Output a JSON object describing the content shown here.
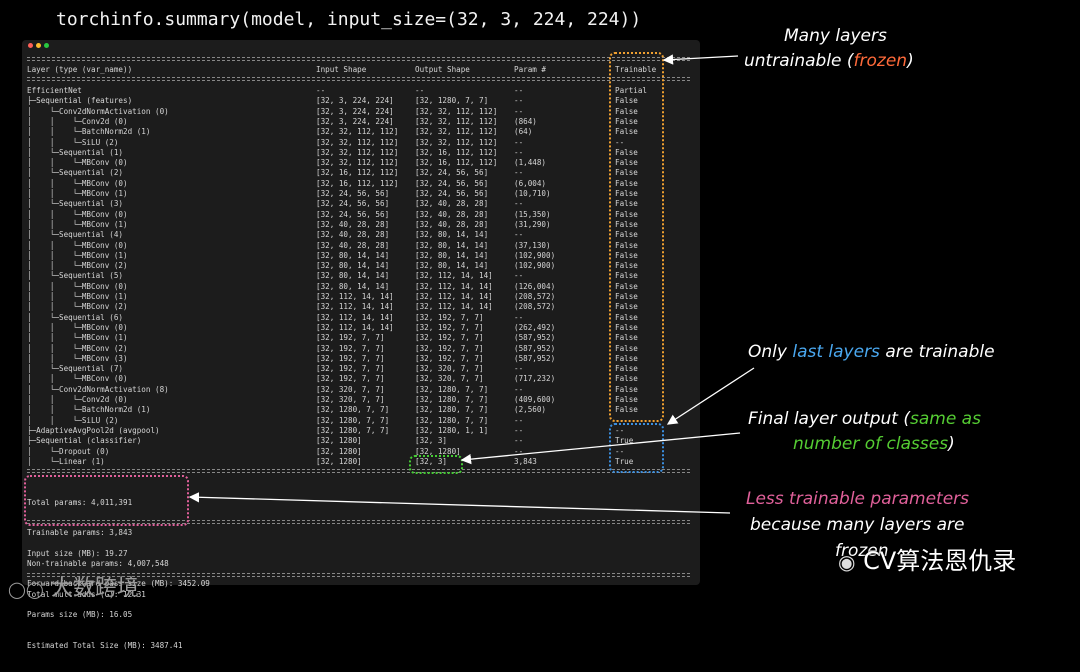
{
  "code_line": "torchinfo.summary(model, input_size=(32, 3, 224, 224))",
  "window_dots": [
    "#ff5f57",
    "#febc2e",
    "#28c840"
  ],
  "header": {
    "layer": "Layer (type (var_name))",
    "input": "Input Shape",
    "output": "Output Shape",
    "param": "Param #",
    "trainable": "Trainable"
  },
  "rows": [
    [
      "EfficientNet",
      "--",
      "--",
      "--",
      "Partial"
    ],
    [
      "├─Sequential (features)",
      "[32, 3, 224, 224]",
      "[32, 1280, 7, 7]",
      "--",
      "False"
    ],
    [
      "│    └─Conv2dNormActivation (0)",
      "[32, 3, 224, 224]",
      "[32, 32, 112, 112]",
      "--",
      "False"
    ],
    [
      "│    │    └─Conv2d (0)",
      "[32, 3, 224, 224]",
      "[32, 32, 112, 112]",
      "(864)",
      "False"
    ],
    [
      "│    │    └─BatchNorm2d (1)",
      "[32, 32, 112, 112]",
      "[32, 32, 112, 112]",
      "(64)",
      "False"
    ],
    [
      "│    │    └─SiLU (2)",
      "[32, 32, 112, 112]",
      "[32, 32, 112, 112]",
      "--",
      "--"
    ],
    [
      "│    └─Sequential (1)",
      "[32, 32, 112, 112]",
      "[32, 16, 112, 112]",
      "--",
      "False"
    ],
    [
      "│    │    └─MBConv (0)",
      "[32, 32, 112, 112]",
      "[32, 16, 112, 112]",
      "(1,448)",
      "False"
    ],
    [
      "│    └─Sequential (2)",
      "[32, 16, 112, 112]",
      "[32, 24, 56, 56]",
      "--",
      "False"
    ],
    [
      "│    │    └─MBConv (0)",
      "[32, 16, 112, 112]",
      "[32, 24, 56, 56]",
      "(6,004)",
      "False"
    ],
    [
      "│    │    └─MBConv (1)",
      "[32, 24, 56, 56]",
      "[32, 24, 56, 56]",
      "(10,710)",
      "False"
    ],
    [
      "│    └─Sequential (3)",
      "[32, 24, 56, 56]",
      "[32, 40, 28, 28]",
      "--",
      "False"
    ],
    [
      "│    │    └─MBConv (0)",
      "[32, 24, 56, 56]",
      "[32, 40, 28, 28]",
      "(15,350)",
      "False"
    ],
    [
      "│    │    └─MBConv (1)",
      "[32, 40, 28, 28]",
      "[32, 40, 28, 28]",
      "(31,290)",
      "False"
    ],
    [
      "│    └─Sequential (4)",
      "[32, 40, 28, 28]",
      "[32, 80, 14, 14]",
      "--",
      "False"
    ],
    [
      "│    │    └─MBConv (0)",
      "[32, 40, 28, 28]",
      "[32, 80, 14, 14]",
      "(37,130)",
      "False"
    ],
    [
      "│    │    └─MBConv (1)",
      "[32, 80, 14, 14]",
      "[32, 80, 14, 14]",
      "(102,900)",
      "False"
    ],
    [
      "│    │    └─MBConv (2)",
      "[32, 80, 14, 14]",
      "[32, 80, 14, 14]",
      "(102,900)",
      "False"
    ],
    [
      "│    └─Sequential (5)",
      "[32, 80, 14, 14]",
      "[32, 112, 14, 14]",
      "--",
      "False"
    ],
    [
      "│    │    └─MBConv (0)",
      "[32, 80, 14, 14]",
      "[32, 112, 14, 14]",
      "(126,004)",
      "False"
    ],
    [
      "│    │    └─MBConv (1)",
      "[32, 112, 14, 14]",
      "[32, 112, 14, 14]",
      "(208,572)",
      "False"
    ],
    [
      "│    │    └─MBConv (2)",
      "[32, 112, 14, 14]",
      "[32, 112, 14, 14]",
      "(208,572)",
      "False"
    ],
    [
      "│    └─Sequential (6)",
      "[32, 112, 14, 14]",
      "[32, 192, 7, 7]",
      "--",
      "False"
    ],
    [
      "│    │    └─MBConv (0)",
      "[32, 112, 14, 14]",
      "[32, 192, 7, 7]",
      "(262,492)",
      "False"
    ],
    [
      "│    │    └─MBConv (1)",
      "[32, 192, 7, 7]",
      "[32, 192, 7, 7]",
      "(587,952)",
      "False"
    ],
    [
      "│    │    └─MBConv (2)",
      "[32, 192, 7, 7]",
      "[32, 192, 7, 7]",
      "(587,952)",
      "False"
    ],
    [
      "│    │    └─MBConv (3)",
      "[32, 192, 7, 7]",
      "[32, 192, 7, 7]",
      "(587,952)",
      "False"
    ],
    [
      "│    └─Sequential (7)",
      "[32, 192, 7, 7]",
      "[32, 320, 7, 7]",
      "--",
      "False"
    ],
    [
      "│    │    └─MBConv (0)",
      "[32, 192, 7, 7]",
      "[32, 320, 7, 7]",
      "(717,232)",
      "False"
    ],
    [
      "│    └─Conv2dNormActivation (8)",
      "[32, 320, 7, 7]",
      "[32, 1280, 7, 7]",
      "--",
      "False"
    ],
    [
      "│    │    └─Conv2d (0)",
      "[32, 320, 7, 7]",
      "[32, 1280, 7, 7]",
      "(409,600)",
      "False"
    ],
    [
      "│    │    └─BatchNorm2d (1)",
      "[32, 1280, 7, 7]",
      "[32, 1280, 7, 7]",
      "(2,560)",
      "False"
    ],
    [
      "│    │    └─SiLU (2)",
      "[32, 1280, 7, 7]",
      "[32, 1280, 7, 7]",
      "--",
      "--"
    ],
    [
      "├─AdaptiveAvgPool2d (avgpool)",
      "[32, 1280, 7, 7]",
      "[32, 1280, 1, 1]",
      "--",
      "--"
    ],
    [
      "├─Sequential (classifier)",
      "[32, 1280]",
      "[32, 3]",
      "--",
      "True"
    ],
    [
      "│    └─Dropout (0)",
      "[32, 1280]",
      "[32, 1280]",
      "--",
      "--"
    ],
    [
      "│    └─Linear (1)",
      "[32, 1280]",
      "[32, 3]",
      "3,843",
      "True"
    ]
  ],
  "totals": [
    "Total params: 4,011,391",
    "Trainable params: 3,843",
    "Non-trainable params: 4,007,548",
    "Total mult-adds (G): 12.31"
  ],
  "sizes": [
    "Input size (MB): 19.27",
    "Forward/backward pass size (MB): 3452.09",
    "Params size (MB): 16.05",
    "Estimated Total Size (MB): 3487.41"
  ],
  "notes": {
    "frozen_a": "Many layers",
    "frozen_b": "untrainable (",
    "frozen_c": "frozen",
    "frozen_d": ")",
    "last_a": "Only ",
    "last_b": "last layers",
    "last_c": " are trainable",
    "final_a": "Final layer output (",
    "final_b": "same as",
    "final_c": "number of classes",
    "final_d": ")",
    "less_a": "Less trainable parameters",
    "less_b": "because many layers are",
    "less_c": "frozen"
  },
  "watermarks": {
    "bottom_left": "大数跨境",
    "bottom_right": "CV算法恩仇录"
  },
  "colors": {
    "orange": "#f0a030",
    "blue": "#3b8fe0",
    "green": "#44cc33",
    "pink": "#e0609a",
    "blue_text": "#4aa8f0",
    "green_text": "#55cc33",
    "orange_text": "#ff6a3a"
  }
}
